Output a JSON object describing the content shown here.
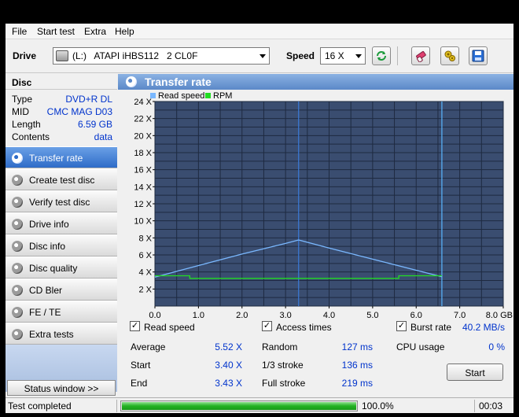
{
  "menu": [
    "File",
    "Start test",
    "Extra",
    "Help"
  ],
  "toolbar": {
    "drive_label": "Drive",
    "drive_value": "(L:)   ATAPI iHBS112   2 CL0F",
    "speed_label": "Speed",
    "speed_value": "16 X"
  },
  "disc": {
    "header": "Disc",
    "rows": [
      {
        "k": "Type",
        "v": "DVD+R DL"
      },
      {
        "k": "MID",
        "v": "CMC MAG D03"
      },
      {
        "k": "Length",
        "v": "6.59 GB"
      },
      {
        "k": "Contents",
        "v": "data"
      }
    ]
  },
  "nav": [
    {
      "label": "Transfer rate",
      "active": true
    },
    {
      "label": "Create test disc",
      "active": false
    },
    {
      "label": "Verify test disc",
      "active": false
    },
    {
      "label": "Drive info",
      "active": false
    },
    {
      "label": "Disc info",
      "active": false
    },
    {
      "label": "Disc quality",
      "active": false
    },
    {
      "label": "CD Bler",
      "active": false
    },
    {
      "label": "FE / TE",
      "active": false
    },
    {
      "label": "Extra tests",
      "active": false
    }
  ],
  "status_window_label": "Status window >>",
  "panel_title": "Transfer rate",
  "chart_data": {
    "type": "line",
    "legend": [
      {
        "name": "Read speed",
        "color": "#7ab8ff"
      },
      {
        "name": "RPM",
        "color": "#22dd22"
      }
    ],
    "x_ticks": [
      "0.0",
      "1.0",
      "2.0",
      "3.0",
      "4.0",
      "5.0",
      "6.0",
      "7.0",
      "8.0 GB"
    ],
    "y_ticks": [
      "2 X",
      "4 X",
      "6 X",
      "8 X",
      "10 X",
      "12 X",
      "14 X",
      "16 X",
      "18 X",
      "20 X",
      "22 X",
      "24 X"
    ],
    "xlim": [
      0,
      8
    ],
    "ylim": [
      0,
      24
    ],
    "series": [
      {
        "name": "Read speed",
        "color": "#7ab8ff",
        "x": [
          0.0,
          1.0,
          2.0,
          3.0,
          3.3,
          4.0,
          5.0,
          6.0,
          6.59
        ],
        "y": [
          3.4,
          4.75,
          6.1,
          7.35,
          7.75,
          6.8,
          5.5,
          4.2,
          3.43
        ]
      },
      {
        "name": "RPM",
        "color": "#22dd22",
        "x": [
          0.0,
          0.8,
          0.8,
          5.6,
          5.6,
          6.59
        ],
        "y": [
          3.55,
          3.55,
          3.25,
          3.25,
          3.55,
          3.55
        ]
      }
    ],
    "markers": [
      {
        "x": 3.3,
        "color": "#3b7bd9"
      },
      {
        "x": 6.59,
        "color": "#59b6ff"
      }
    ],
    "background": "#3a4d70",
    "grid_color": "#1e2a40",
    "grid": true
  },
  "stats": {
    "read_speed_label": "Read speed",
    "access_times_label": "Access times",
    "burst_rate_label": "Burst rate",
    "burst_rate_value": "40.2 MB/s",
    "checkmark": "✓",
    "rows": [
      {
        "l1": "Average",
        "v1": "5.52 X",
        "l2": "Random",
        "v2": "127 ms",
        "l3": "CPU usage",
        "v3": "0 %"
      },
      {
        "l1": "Start",
        "v1": "3.40 X",
        "l2": "1/3 stroke",
        "v2": "136 ms"
      },
      {
        "l1": "End",
        "v1": "3.43 X",
        "l2": "Full stroke",
        "v2": "219 ms"
      }
    ],
    "start_label": "Start"
  },
  "statusbar": {
    "text": "Test completed",
    "progress": 1.0,
    "pct": "100.0%",
    "elapsed": "00:03"
  }
}
